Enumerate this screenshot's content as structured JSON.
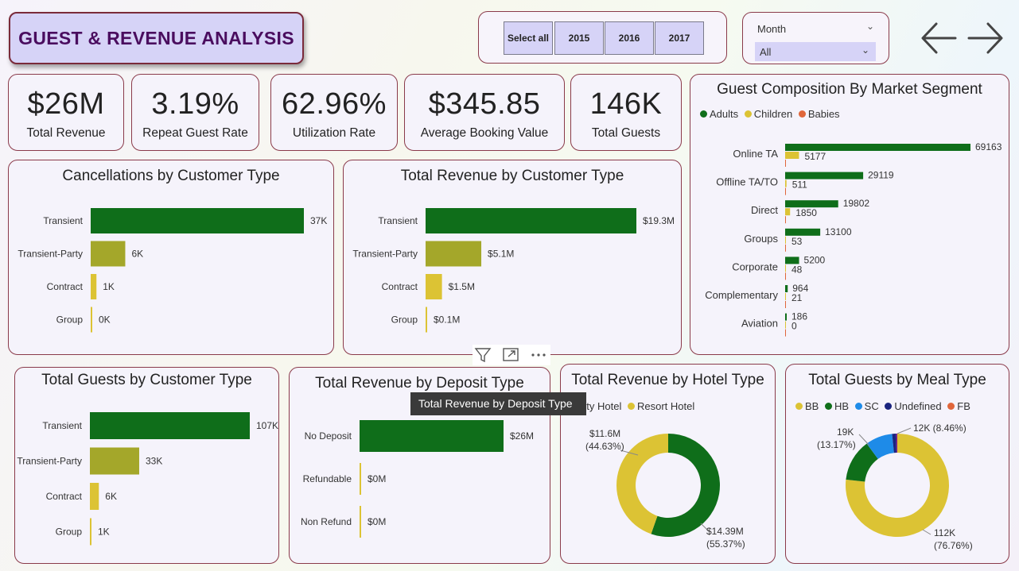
{
  "title": "GUEST & REVENUE ANALYSIS",
  "year_slicer": {
    "buttons": [
      "Select all",
      "2015",
      "2016",
      "2017"
    ]
  },
  "month_slicer": {
    "label": "Month",
    "value": "All"
  },
  "icons": {
    "prev": "arrow-left-icon",
    "next": "arrow-right-icon",
    "filter": "filter-icon",
    "focus": "focus-mode-icon",
    "more": "more-options-icon"
  },
  "kpis": [
    {
      "value": "$26M",
      "label": "Total Revenue"
    },
    {
      "value": "3.19%",
      "label": "Repeat Guest Rate"
    },
    {
      "value": "62.96%",
      "label": "Utilization Rate"
    },
    {
      "value": "$345.85",
      "label": "Average Booking Value"
    },
    {
      "value": "146K",
      "label": "Total Guests"
    }
  ],
  "colors": {
    "dark_green": "#0f6e1a",
    "olive": "#a4a72a",
    "yellow": "#dcc334",
    "orange": "#e0663a",
    "bright_blue": "#1e8be8",
    "navy": "#1a237e",
    "purple": "#7a1a8a"
  },
  "tooltip": "Total Revenue by Deposit Type",
  "chart_data": [
    {
      "id": "cancellations",
      "type": "bar",
      "title": "Cancellations by Customer Type",
      "categories": [
        "Transient",
        "Transient-Party",
        "Contract",
        "Group"
      ],
      "values": [
        37000,
        6000,
        1000,
        0
      ],
      "labels": [
        "37K",
        "6K",
        "1K",
        "0K"
      ]
    },
    {
      "id": "revenue_customer",
      "type": "bar",
      "title": "Total Revenue by Customer Type",
      "categories": [
        "Transient",
        "Transient-Party",
        "Contract",
        "Group"
      ],
      "values": [
        19.3,
        5.1,
        1.5,
        0.1
      ],
      "labels": [
        "$19.3M",
        "$5.1M",
        "$1.5M",
        "$0.1M"
      ]
    },
    {
      "id": "guest_composition",
      "type": "bar",
      "title": "Guest Composition By Market Segment",
      "legend": [
        "Adults",
        "Children",
        "Babies"
      ],
      "categories": [
        "Online TA",
        "Offline TA/TO",
        "Direct",
        "Groups",
        "Corporate",
        "Complementary",
        "Aviation"
      ],
      "series": [
        {
          "name": "Adults",
          "values": [
            69163,
            29119,
            19802,
            13100,
            5200,
            964,
            186
          ]
        },
        {
          "name": "Children",
          "values": [
            5177,
            511,
            1850,
            53,
            48,
            21,
            0
          ]
        },
        {
          "name": "Babies",
          "values": [
            0,
            0,
            0,
            0,
            0,
            0,
            0
          ]
        }
      ],
      "labels_adults": [
        "69163",
        "29119",
        "19802",
        "13100",
        "5200",
        "964",
        "186"
      ],
      "labels_children": [
        "5177",
        "511",
        "1850",
        "53",
        "48",
        "21",
        "0"
      ]
    },
    {
      "id": "guests_customer",
      "type": "bar",
      "title": "Total Guests by Customer Type",
      "categories": [
        "Transient",
        "Transient-Party",
        "Contract",
        "Group"
      ],
      "values": [
        107000,
        33000,
        6000,
        1000
      ],
      "labels": [
        "107K",
        "33K",
        "6K",
        "1K"
      ]
    },
    {
      "id": "revenue_deposit",
      "type": "bar",
      "title": "Total Revenue by Deposit Type",
      "categories": [
        "No Deposit",
        "Refundable",
        "Non Refund"
      ],
      "values": [
        26,
        0,
        0
      ],
      "labels": [
        "$26M",
        "$0M",
        "$0M"
      ]
    },
    {
      "id": "revenue_hotel",
      "type": "pie",
      "title": "Total Revenue by Hotel Type",
      "legend": [
        "City Hotel",
        "Resort Hotel"
      ],
      "values": [
        14.39,
        11.6
      ],
      "percents": [
        55.37,
        44.63
      ],
      "labels": [
        "$14.39M",
        "$11.6M"
      ],
      "pct_labels": [
        "(55.37%)",
        "(44.63%)"
      ]
    },
    {
      "id": "guests_meal",
      "type": "pie",
      "title": "Total Guests by Meal Type",
      "legend": [
        "BB",
        "HB",
        "SC",
        "Undefined",
        "FB"
      ],
      "values": [
        112000,
        19000,
        12000,
        1000,
        500
      ],
      "percents": [
        76.76,
        13.17,
        8.46,
        1.2,
        0.41
      ],
      "labels": [
        "112K",
        "19K",
        "12K (8.46%)"
      ],
      "pct_labels": [
        "(76.76%)",
        "(13.17%)"
      ]
    }
  ]
}
